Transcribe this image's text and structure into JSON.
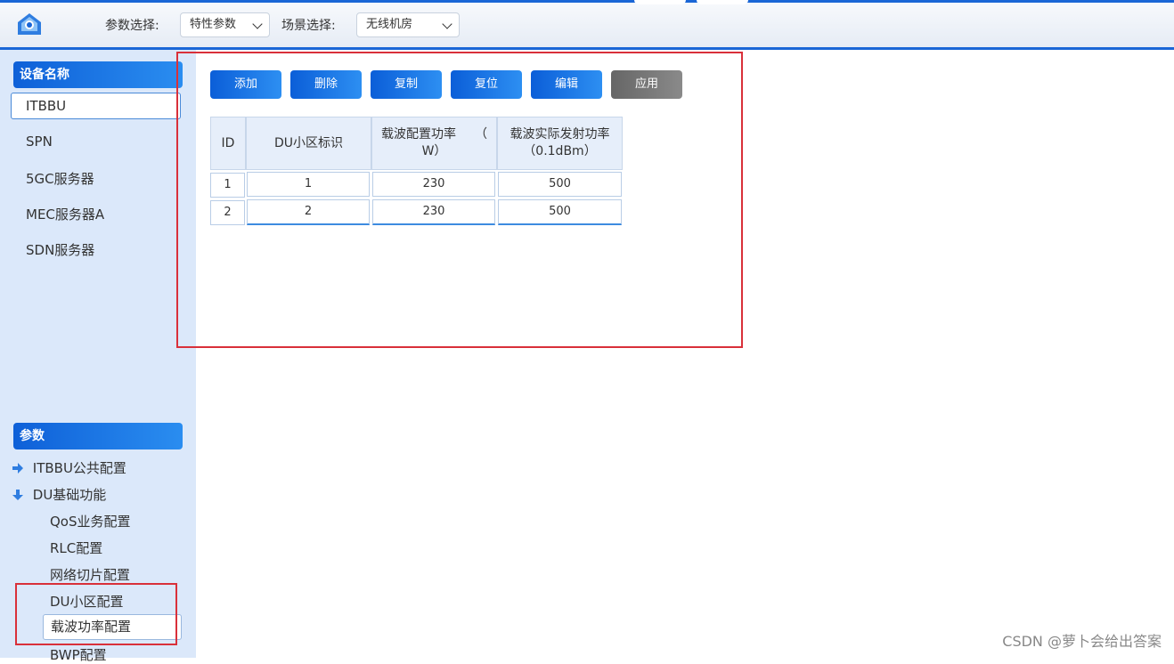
{
  "header": {
    "param_label": "参数选择:",
    "param_value": "特性参数",
    "scene_label": "场景选择:",
    "scene_value": "无线机房"
  },
  "sidebar": {
    "device_title": "设备名称",
    "devices": [
      "ITBBU",
      "SPN",
      "5GC服务器",
      "MEC服务器A",
      "SDN服务器"
    ],
    "params_title": "参数",
    "tree": {
      "group1": "ITBBU公共配置",
      "group2": "DU基础功能",
      "children": [
        "QoS业务配置",
        "RLC配置",
        "网络切片配置",
        "DU小区配置",
        "载波功率配置",
        "BWP配置"
      ]
    }
  },
  "toolbar": {
    "add": "添加",
    "delete": "删除",
    "copy": "复制",
    "reset": "复位",
    "edit": "编辑",
    "apply": "应用"
  },
  "table": {
    "headers": {
      "id": "ID",
      "du_cell": "DU小区标识",
      "cfg_power_line1": "载波配置功率　　（",
      "cfg_power_line2": "W）",
      "actual_power_line1": "载波实际发射功率",
      "actual_power_line2": "（0.1dBm）"
    },
    "rows": [
      {
        "id": "1",
        "du_cell": "1",
        "cfg_power": "230",
        "actual_power": "500"
      },
      {
        "id": "2",
        "du_cell": "2",
        "cfg_power": "230",
        "actual_power": "500"
      }
    ]
  },
  "watermark": "CSDN @萝卜会给出答案",
  "colors": {
    "accent": "#1a66d6",
    "highlight_box": "#d9303a",
    "sidebar_bg": "#dbe8fa"
  }
}
